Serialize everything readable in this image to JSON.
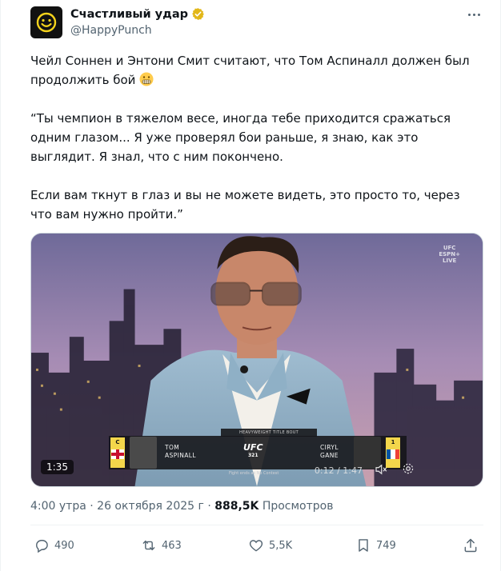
{
  "author": {
    "display_name": "Счастливый удар",
    "handle": "@HappyPunch",
    "verified": true,
    "avatar_icon": "smiley-face-icon"
  },
  "tweet": {
    "line1": "Чейл Соннен и Энтони Смит считают, что Том Аспиналл должен был продолжить бой",
    "line1_emoji": "grimacing-face-emoji",
    "quote1": "“Ты чемпион в тяжелом весе, иногда тебе приходится сражаться одним глазом... Я уже проверял бои раньше, я знаю, как это выглядит. Я знал, что с ним покончено.",
    "quote2": "Если вам ткнут в глаз и вы не можете видеть, это просто то, через что вам нужно пройти.”"
  },
  "video": {
    "duration_badge": "1:35",
    "progress": "0:12 / 1:47",
    "broadcaster_badge": [
      "UFC",
      "ESPN+",
      "LIVE"
    ],
    "lower_third": {
      "header": "HEAVYWEIGHT TITLE BOUT",
      "left_rank": "C",
      "left_first": "TOM",
      "left_last": "ASPINALL",
      "event_logo": "UFC",
      "event_number": "321",
      "right_first": "CIRYL",
      "right_last": "GANE",
      "right_rank": "1",
      "footer": "Fight ends as No Contest"
    }
  },
  "meta": {
    "time": "4:00 утра",
    "separator": "·",
    "date": "26 октября 2025 г",
    "views": "888,5K",
    "views_label": "Просмотров"
  },
  "actions": {
    "replies": "490",
    "reposts": "463",
    "likes": "5,5K",
    "bookmarks": "749"
  },
  "colors": {
    "text": "#0f1419",
    "secondary": "#536471",
    "verified_gold": "#e2b719",
    "border": "#eff3f4"
  }
}
